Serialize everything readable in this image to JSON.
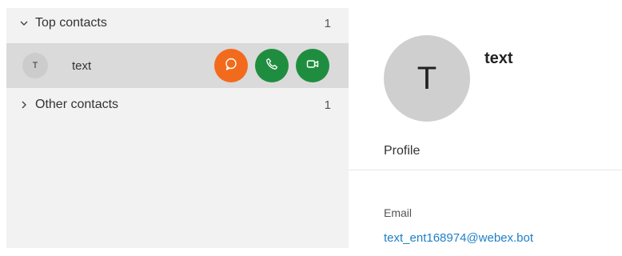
{
  "contacts_list": {
    "top_section": {
      "label": "Top contacts",
      "count": "1",
      "icon": "chevron-down-icon"
    },
    "items": [
      {
        "avatar_initial": "T",
        "name": "text",
        "actions": [
          {
            "icon": "chat-icon",
            "color": "#f26b1d"
          },
          {
            "icon": "phone-icon",
            "color": "#1f8d3f"
          },
          {
            "icon": "video-icon",
            "color": "#1f8d3f"
          }
        ]
      }
    ],
    "other_section": {
      "label": "Other contacts",
      "count": "1",
      "icon": "chevron-right-icon"
    }
  },
  "details": {
    "avatar_initial": "T",
    "name": "text",
    "profile_label": "Profile",
    "email_label": "Email",
    "email_value": "text_ent168974@webex.bot"
  }
}
